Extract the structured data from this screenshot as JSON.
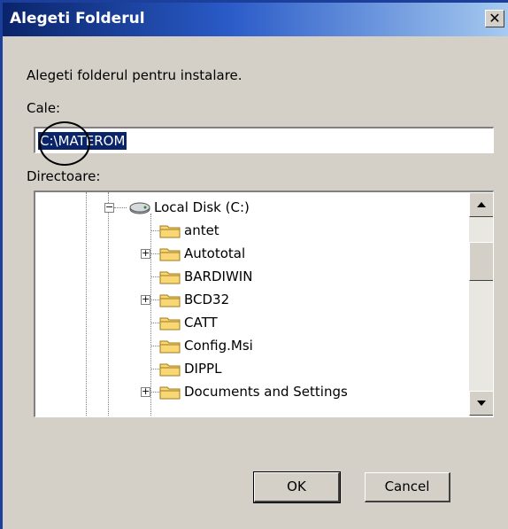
{
  "window": {
    "title": "Alegeti Folderul",
    "close_glyph": "✕"
  },
  "prompt": "Alegeti folderul pentru instalare.",
  "path": {
    "label": "Cale:",
    "value": "C:\\MATEROM"
  },
  "directories": {
    "label": "Directoare:",
    "items": [
      {
        "name": "Local Disk (C:)",
        "icon": "drive-icon",
        "expander": "−"
      },
      {
        "name": "antet",
        "icon": "folder-icon",
        "expander": ""
      },
      {
        "name": "Autototal",
        "icon": "folder-icon",
        "expander": "+"
      },
      {
        "name": "BARDIWIN",
        "icon": "folder-icon",
        "expander": ""
      },
      {
        "name": "BCD32",
        "icon": "folder-icon",
        "expander": "+"
      },
      {
        "name": "CATT",
        "icon": "folder-icon",
        "expander": ""
      },
      {
        "name": "Config.Msi",
        "icon": "folder-icon",
        "expander": ""
      },
      {
        "name": "DIPPL",
        "icon": "folder-icon",
        "expander": ""
      },
      {
        "name": "Documents and Settings",
        "icon": "folder-icon",
        "expander": "+"
      }
    ]
  },
  "buttons": {
    "ok": "OK",
    "cancel": "Cancel"
  },
  "colors": {
    "title_bar": "#0a246a",
    "selection": "#0a246a",
    "dialog_bg": "#d4d0c8",
    "folder": "#f8d775"
  }
}
